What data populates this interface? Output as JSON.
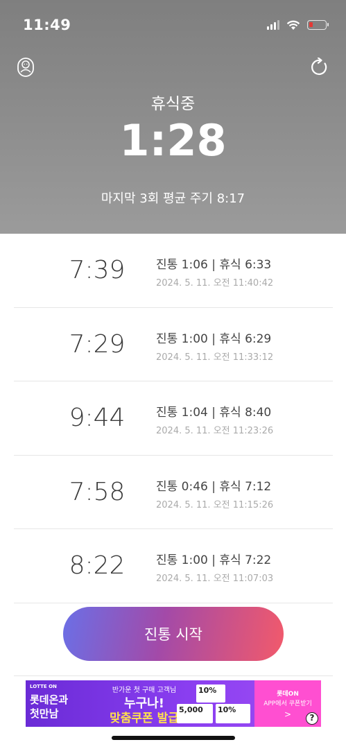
{
  "status_bar": {
    "time": "11:49"
  },
  "header": {
    "state_label": "휴식중",
    "timer": "1:28",
    "average_line": "마지막 3회 평균 주기 8:17"
  },
  "entries": [
    {
      "interval": "7:39",
      "detail": "진통 1:06 | 휴식 6:33",
      "timestamp": "2024. 5. 11. 오전 11:40:42"
    },
    {
      "interval": "7:29",
      "detail": "진통 1:00 | 휴식 6:29",
      "timestamp": "2024. 5. 11. 오전 11:33:12"
    },
    {
      "interval": "9:44",
      "detail": "진통 1:04 | 휴식 8:40",
      "timestamp": "2024. 5. 11. 오전 11:23:26"
    },
    {
      "interval": "7:58",
      "detail": "진통 0:46 | 휴식 7:12",
      "timestamp": "2024. 5. 11. 오전 11:15:26"
    },
    {
      "interval": "8:22",
      "detail": "진통 1:00 | 휴식 7:22",
      "timestamp": "2024. 5. 11. 오전 11:07:03"
    }
  ],
  "start_button": {
    "label": "진통 시작"
  },
  "ad": {
    "brand": "LOTTE ON",
    "headline_1": "롯데온과",
    "headline_2": "첫만남",
    "subline": "반가운 첫 구매 고객님",
    "big_line_1": "누구나!",
    "big_line_2": "맞춤쿠폰 발급",
    "card_top": "10%",
    "card_left": "5,000",
    "card_right": "10%",
    "right_line_1": "롯데ON",
    "right_line_2": "APP에서 쿠폰받기",
    "right_arrow": ">",
    "help": "?"
  },
  "colors": {
    "battery_low": "#e53935",
    "button_gradient_start": "#6b6fe6",
    "button_gradient_end": "#f25a6b"
  }
}
